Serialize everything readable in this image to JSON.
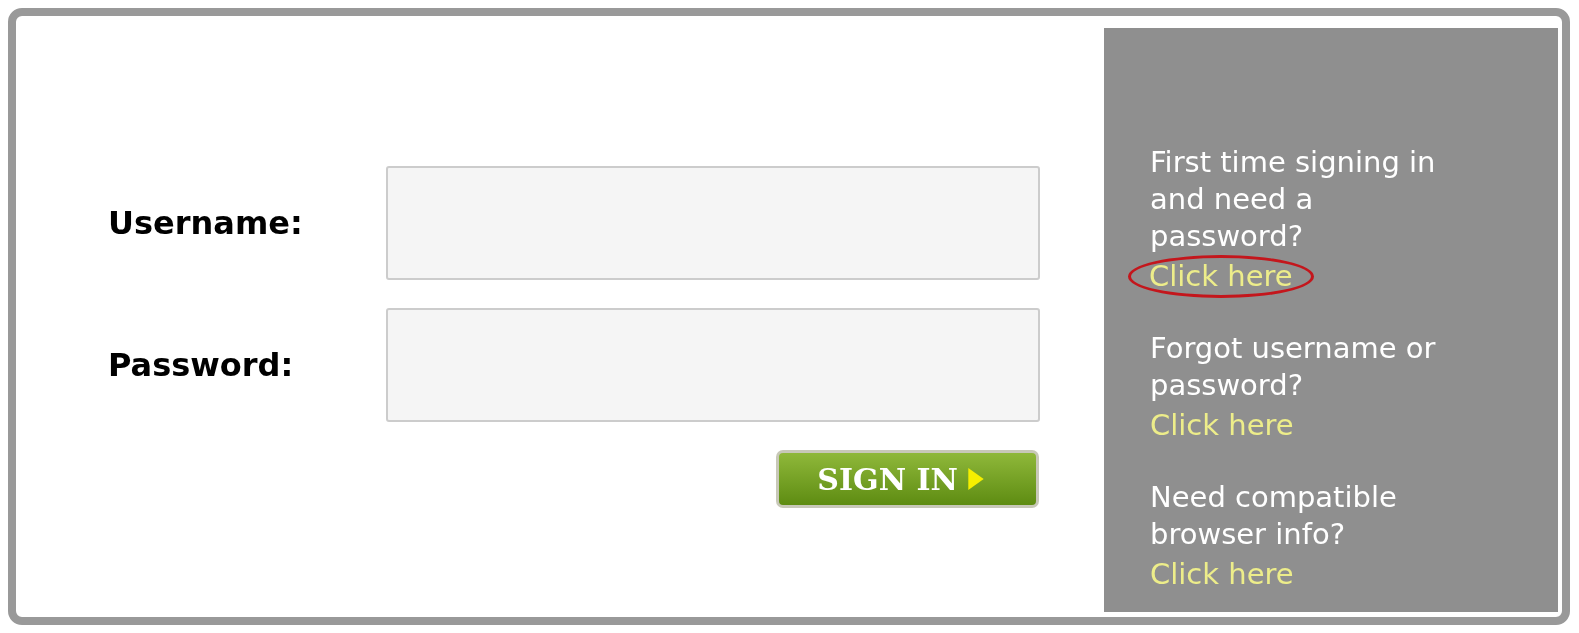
{
  "form": {
    "fields": [
      {
        "label": "Username:"
      },
      {
        "label": "Password:"
      }
    ],
    "button": "SIGN IN"
  },
  "help": [
    {
      "lines": [
        "First time signing in",
        "and need a",
        "password?"
      ],
      "link": "Click here",
      "circled": true
    },
    {
      "lines": [
        "Forgot username or",
        "password?"
      ],
      "link": "Click here",
      "circled": false
    },
    {
      "lines": [
        "Need compatible",
        "browser info?"
      ],
      "link": "Click here",
      "circled": false
    }
  ]
}
